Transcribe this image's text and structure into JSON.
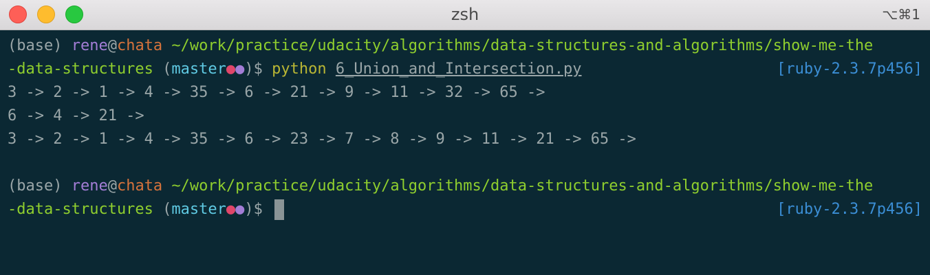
{
  "window": {
    "title": "zsh",
    "shortcut": "⌥⌘1"
  },
  "colors": {
    "background": "#0b2833",
    "user": "#a37dd6",
    "host": "#d6733c",
    "path": "#8fce2e",
    "branch": "#5fc9e2",
    "command": "#b9b634",
    "ruby": "#3b8ed5"
  },
  "prompt": {
    "env": "(base) ",
    "user": "rene",
    "at": "@",
    "host": "chata",
    "path_line1": " ~/work/practice/udacity/algorithms/data-structures-and-algorithms/show-me-the",
    "path_line2": "-data-structures",
    "paren_open": " (",
    "branch": "master",
    "dot1": "●",
    "dot2": "●",
    "paren_close": ")",
    "dollar": "$ ",
    "ruby": "[ruby-2.3.7p456]"
  },
  "session": {
    "command": "python",
    "argument": "6_Union_and_Intersection.py",
    "output": [
      "3 -> 2 -> 1 -> 4 -> 35 -> 6 -> 21 -> 9 -> 11 -> 32 -> 65 ->",
      "6 -> 4 -> 21 ->",
      "3 -> 2 -> 1 -> 4 -> 35 -> 6 -> 23 -> 7 -> 8 -> 9 -> 11 -> 21 -> 65 ->",
      ""
    ]
  }
}
